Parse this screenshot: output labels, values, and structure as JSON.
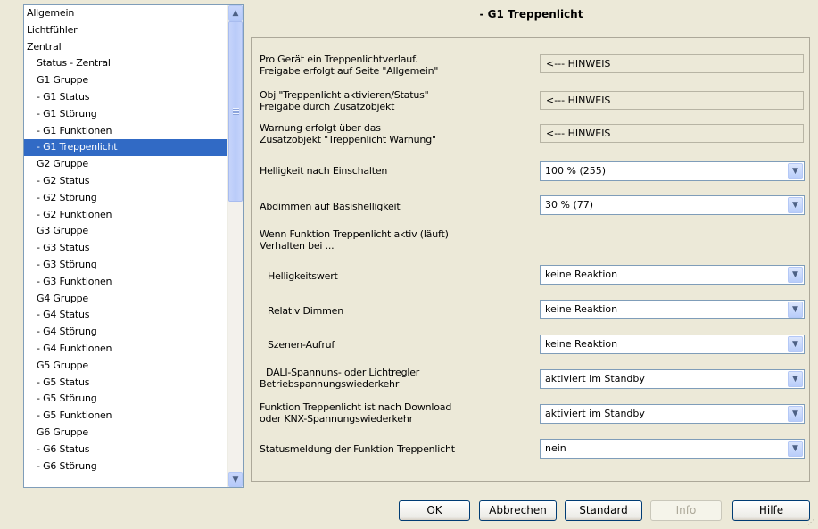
{
  "tree": {
    "items": [
      {
        "label": "Allgemein",
        "level": 0
      },
      {
        "label": "Lichtfühler",
        "level": 0
      },
      {
        "label": "Zentral",
        "level": 0
      },
      {
        "label": "Status - Zentral",
        "level": 1
      },
      {
        "label": "G1 Gruppe",
        "level": 1
      },
      {
        "label": "- G1 Status",
        "level": 1
      },
      {
        "label": "- G1 Störung",
        "level": 1
      },
      {
        "label": "- G1 Funktionen",
        "level": 1
      },
      {
        "label": "- G1 Treppenlicht",
        "level": 1,
        "selected": true
      },
      {
        "label": "G2 Gruppe",
        "level": 1
      },
      {
        "label": "- G2 Status",
        "level": 1
      },
      {
        "label": "- G2 Störung",
        "level": 1
      },
      {
        "label": "- G2 Funktionen",
        "level": 1
      },
      {
        "label": "G3 Gruppe",
        "level": 1
      },
      {
        "label": "- G3 Status",
        "level": 1
      },
      {
        "label": "- G3 Störung",
        "level": 1
      },
      {
        "label": "- G3 Funktionen",
        "level": 1
      },
      {
        "label": "G4 Gruppe",
        "level": 1
      },
      {
        "label": "- G4 Status",
        "level": 1
      },
      {
        "label": "- G4 Störung",
        "level": 1
      },
      {
        "label": "- G4 Funktionen",
        "level": 1
      },
      {
        "label": "G5 Gruppe",
        "level": 1
      },
      {
        "label": "- G5 Status",
        "level": 1
      },
      {
        "label": "- G5 Störung",
        "level": 1
      },
      {
        "label": "- G5 Funktionen",
        "level": 1
      },
      {
        "label": "G6 Gruppe",
        "level": 1
      },
      {
        "label": "- G6 Status",
        "level": 1
      },
      {
        "label": "- G6 Störung",
        "level": 1
      }
    ],
    "scroll_up_icon": "arrow-up-icon",
    "scroll_down_icon": "arrow-down-icon"
  },
  "page": {
    "title": "- G1 Treppenlicht"
  },
  "params": {
    "p1": {
      "label_line1": "Pro Gerät ein Treppenlichtverlauf.",
      "label_line2": "Freigabe erfolgt auf Seite \"Allgemein\"",
      "value": "<--- HINWEIS"
    },
    "p2": {
      "label_line1": "Obj \"Treppenlicht aktivieren/Status\"",
      "label_line2": "Freigabe durch Zusatzobjekt",
      "value": "<--- HINWEIS"
    },
    "p3": {
      "label_line1": "Warnung erfolgt über das",
      "label_line2": "Zusatzobjekt \"Treppenlicht Warnung\"",
      "value": "<--- HINWEIS"
    },
    "p4": {
      "label": "Helligkeit nach Einschalten",
      "value": "100 % (255)"
    },
    "p5": {
      "label": "Abdimmen auf Basishelligkeit",
      "value": "30 %  (77)"
    },
    "section": {
      "line1": "Wenn Funktion Treppenlicht aktiv (läuft)",
      "line2": "Verhalten bei ..."
    },
    "p6": {
      "label": "Helligkeitswert",
      "value": "keine Reaktion"
    },
    "p7": {
      "label": "Relativ Dimmen",
      "value": "keine Reaktion"
    },
    "p8": {
      "label": "Szenen-Aufruf",
      "value": "keine Reaktion"
    },
    "p9": {
      "label_line1": "DALI-Spannuns- oder Lichtregler",
      "label_line2": "Betriebspannungswiederkehr",
      "value": "aktiviert im Standby"
    },
    "p10": {
      "label_line1": "Funktion Treppenlicht ist nach Download",
      "label_line2": "oder KNX-Spannungswiederkehr",
      "value": "aktiviert im Standby"
    },
    "p11": {
      "label": "Statusmeldung der Funktion Treppenlicht",
      "value": "nein"
    }
  },
  "buttons": {
    "ok": "OK",
    "cancel": "Abbrechen",
    "standard": "Standard",
    "info": "Info",
    "help": "Hilfe"
  }
}
